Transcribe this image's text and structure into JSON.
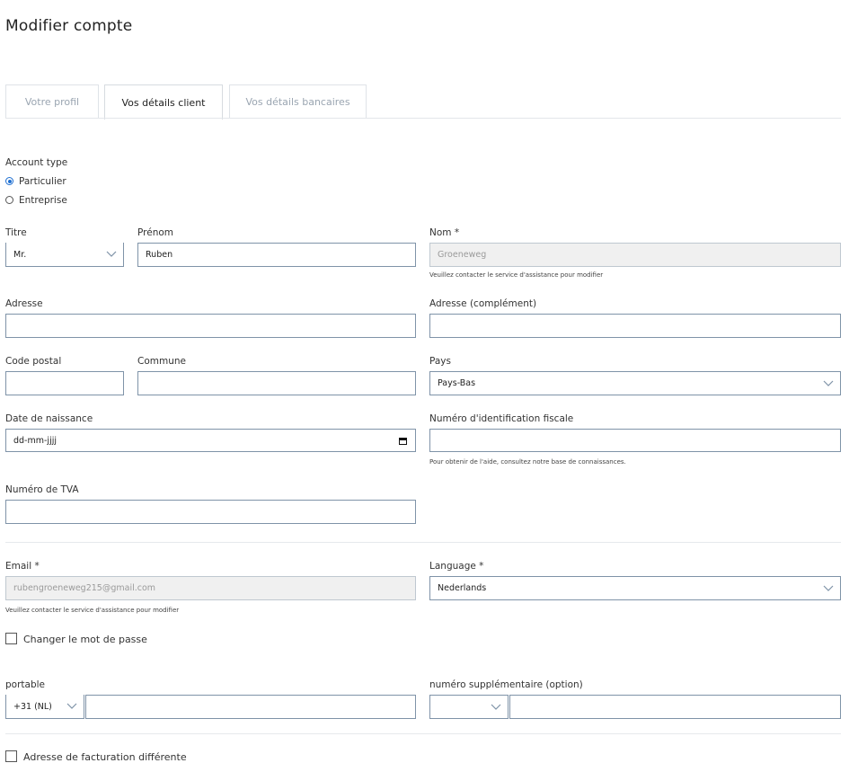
{
  "page_title": "Modifier compte",
  "tabs": [
    {
      "label": "Votre profil"
    },
    {
      "label": "Vos détails client"
    },
    {
      "label": "Vos détails bancaires"
    }
  ],
  "account_type": {
    "label": "Account type",
    "options": [
      {
        "label": "Particulier",
        "checked": true
      },
      {
        "label": "Entreprise",
        "checked": false
      }
    ]
  },
  "fields": {
    "titre": {
      "label": "Titre",
      "value": "Mr."
    },
    "prenom": {
      "label": "Prénom",
      "value": "Ruben"
    },
    "nom": {
      "label": "Nom *",
      "value": "Groeneweg",
      "hint": "Veuillez contacter le service d'assistance pour modifier"
    },
    "adresse": {
      "label": "Adresse",
      "value": ""
    },
    "adresse_complement": {
      "label": "Adresse (complément)",
      "value": ""
    },
    "code_postal": {
      "label": "Code postal",
      "value": ""
    },
    "commune": {
      "label": "Commune",
      "value": ""
    },
    "pays": {
      "label": "Pays",
      "value": "Pays-Bas"
    },
    "date_naissance": {
      "label": "Date de naissance",
      "placeholder": "dd-mm-jjjj"
    },
    "num_fiscal": {
      "label": "Numéro d'identification fiscale",
      "value": "",
      "hint": "Pour obtenir de l'aide, consultez notre base de connaissances."
    },
    "num_tva": {
      "label": "Numéro de TVA",
      "value": ""
    },
    "email": {
      "label": "Email *",
      "value": "rubengroeneweg215@gmail.com",
      "hint": "Veuillez contacter le service d'assistance pour modifier"
    },
    "language": {
      "label": "Language *",
      "value": "Nederlands"
    },
    "portable": {
      "label": "portable",
      "prefix": "+31 (NL)",
      "value": ""
    },
    "supplementaire": {
      "label": "numéro supplémentaire (option)",
      "prefix": "",
      "value": ""
    }
  },
  "change_password": {
    "label": "Changer le mot de passe",
    "checked": false
  },
  "billing_address": {
    "label": "Adresse de facturation différente",
    "checked": false
  },
  "colors": {
    "accent": "#1f6fd1",
    "border": "#7f93a8",
    "disabled_bg": "#f0f0f0"
  }
}
